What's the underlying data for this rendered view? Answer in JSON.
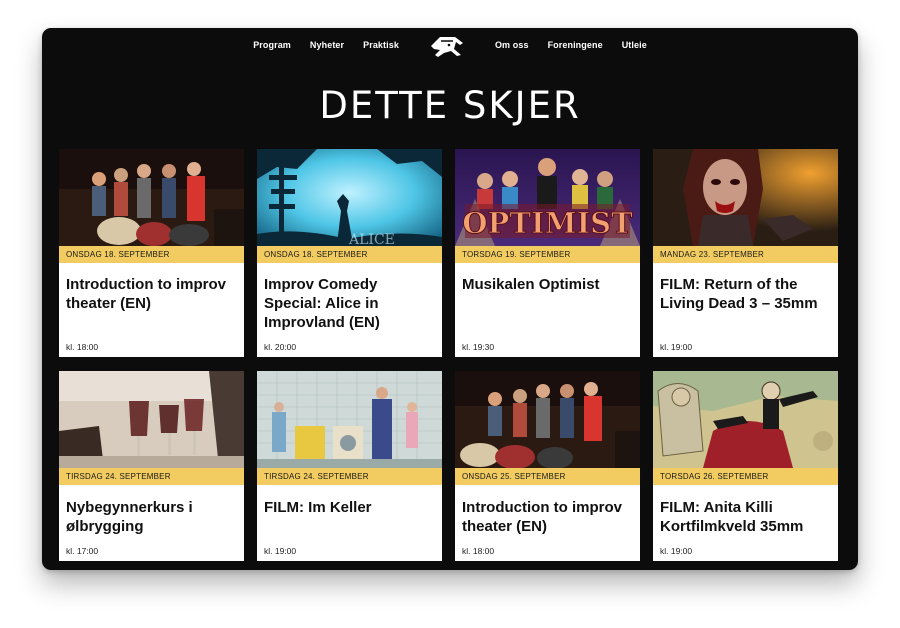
{
  "nav": {
    "left": [
      "Program",
      "Nyheter",
      "Praktisk"
    ],
    "right": [
      "Om oss",
      "Foreningene",
      "Utleie"
    ],
    "logo": "house-fox-logo"
  },
  "page": {
    "title": "DETTE SKJER"
  },
  "events": [
    {
      "date": "ONSDAG 18. SEPTEMBER",
      "title": "Introduction to improv theater (EN)",
      "time": "kl. 18:00"
    },
    {
      "date": "ONSDAG 18. SEPTEMBER",
      "title": "Improv Comedy Special: Alice in Improvland (EN)",
      "time": "kl. 20:00"
    },
    {
      "date": "TORSDAG 19. SEPTEMBER",
      "title": "Musikalen Optimist",
      "time": "kl. 19:30",
      "image_text": "OPTIMIST"
    },
    {
      "date": "MANDAG 23. SEPTEMBER",
      "title": "FILM: Return of the Living Dead 3 – 35mm",
      "time": "kl. 19:00"
    },
    {
      "date": "TIRSDAG 24. SEPTEMBER",
      "title": "Nybegynnerkurs i ølbrygging",
      "time": "kl. 17:00"
    },
    {
      "date": "TIRSDAG 24. SEPTEMBER",
      "title": "FILM: Im Keller",
      "time": "kl. 19:00"
    },
    {
      "date": "ONSDAG 25. SEPTEMBER",
      "title": "Introduction to improv theater (EN)",
      "time": "kl. 18:00"
    },
    {
      "date": "TORSDAG 26. SEPTEMBER",
      "title": "FILM: Anita Killi Kortfilmkveld 35mm",
      "time": "kl. 19:00"
    }
  ],
  "colors": {
    "background": "#0c0c0c",
    "date_bar": "#f2cc61",
    "card": "#ffffff"
  }
}
